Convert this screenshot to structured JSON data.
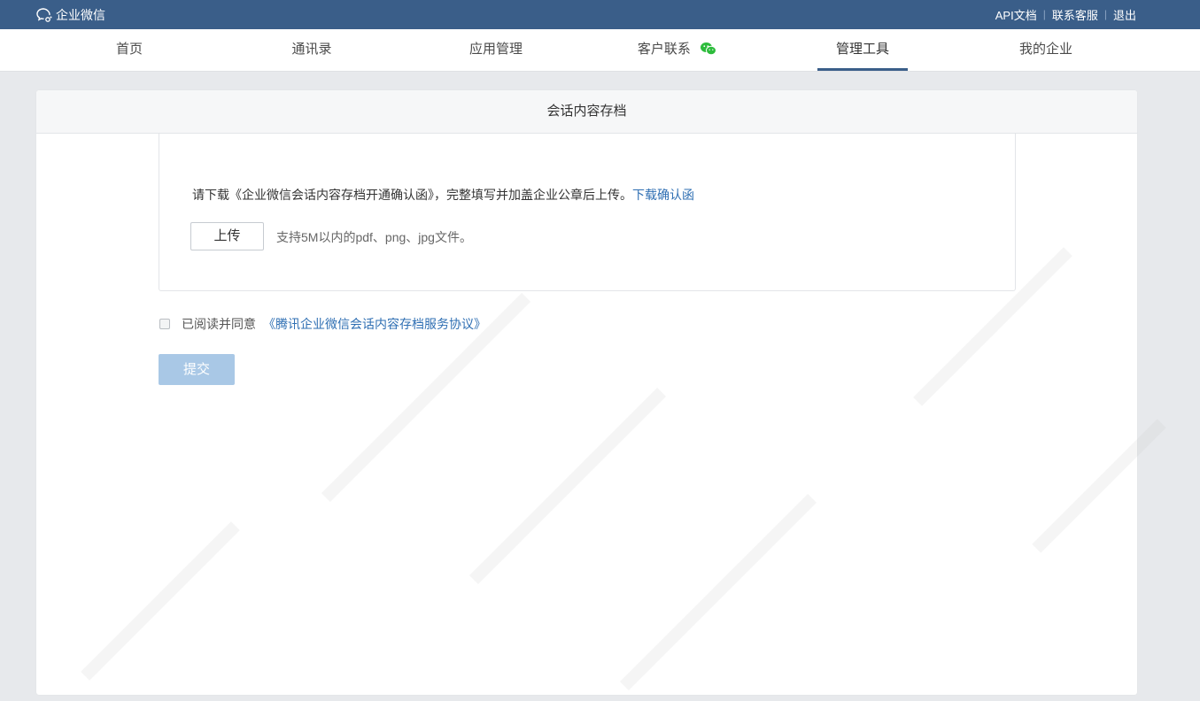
{
  "header": {
    "brand": "企业微信",
    "links": [
      "API文档",
      "联系客服",
      "退出"
    ]
  },
  "nav": {
    "items": [
      {
        "label": "首页"
      },
      {
        "label": "通讯录"
      },
      {
        "label": "应用管理"
      },
      {
        "label": "客户联系"
      },
      {
        "label": "管理工具",
        "active": true
      },
      {
        "label": "我的企业"
      }
    ]
  },
  "panel": {
    "title": "会话内容存档",
    "instruction_text": "请下载《企业微信会话内容存档开通确认函》，完整填写并加盖企业公章后上传。",
    "download_link": "下载确认函",
    "upload_button": "上传",
    "upload_hint": "支持5M以内的pdf、png、jpg文件。",
    "agree_label": "已阅读并同意",
    "agreement_link": "《腾讯企业微信会话内容存档服务协议》",
    "submit_button": "提交"
  },
  "colors": {
    "topbar": "#3a5e89",
    "link": "#2f6fb3",
    "submit_disabled": "#a9c8e6"
  },
  "icons": [
    "wechat-logo-icon",
    "wechat-icon"
  ]
}
